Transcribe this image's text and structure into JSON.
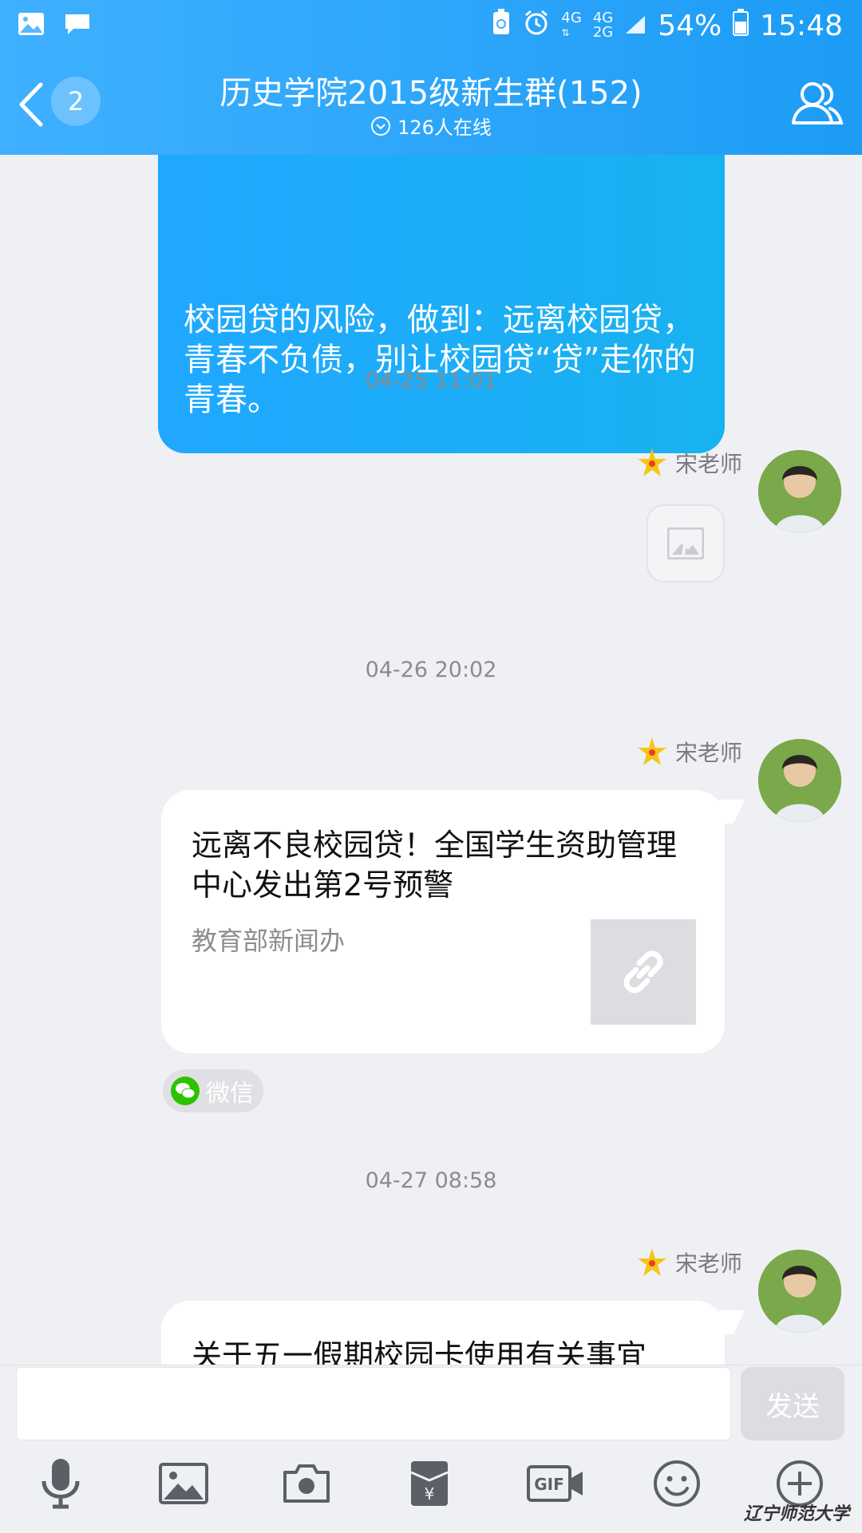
{
  "status_bar": {
    "network_primary": "4G",
    "network_secondary_top": "4G",
    "network_secondary_bottom": "2G",
    "battery": "54%",
    "time": "15:48"
  },
  "header": {
    "title": "历史学院2015级新生群(152)",
    "online": "126人在线",
    "unread_count": "2"
  },
  "messages": {
    "prev_bubble_text": "校园贷的风险，做到：远离校园贷，青春不负债，别让校园贷“贷”走你的青春。",
    "ts1": "04-25 11:01",
    "sender1": "宋老师",
    "ts2": "04-26 20:02",
    "sender2": "宋老师",
    "card1_title": "远离不良校园贷！全国学生资助管理中心发出第2号预警",
    "card1_source": "教育部新闻办",
    "wechat_label": "微信",
    "ts3": "04-27 08:58",
    "sender3": "宋老师",
    "card2_title": "关于五一假期校园卡使用有关事宜"
  },
  "input": {
    "placeholder": "",
    "send_label": "发送"
  },
  "toolbar": {
    "icons": [
      "microphone-icon",
      "image-icon",
      "camera-icon",
      "red-packet-icon",
      "gif-icon",
      "emoji-icon",
      "plus-icon"
    ]
  },
  "watermark": "辽宁师范大学",
  "colors": {
    "header_start": "#3fb0ff",
    "header_end": "#1c9cf5",
    "bubble_blue": "#20a8ff",
    "background": "#eff0f4"
  }
}
